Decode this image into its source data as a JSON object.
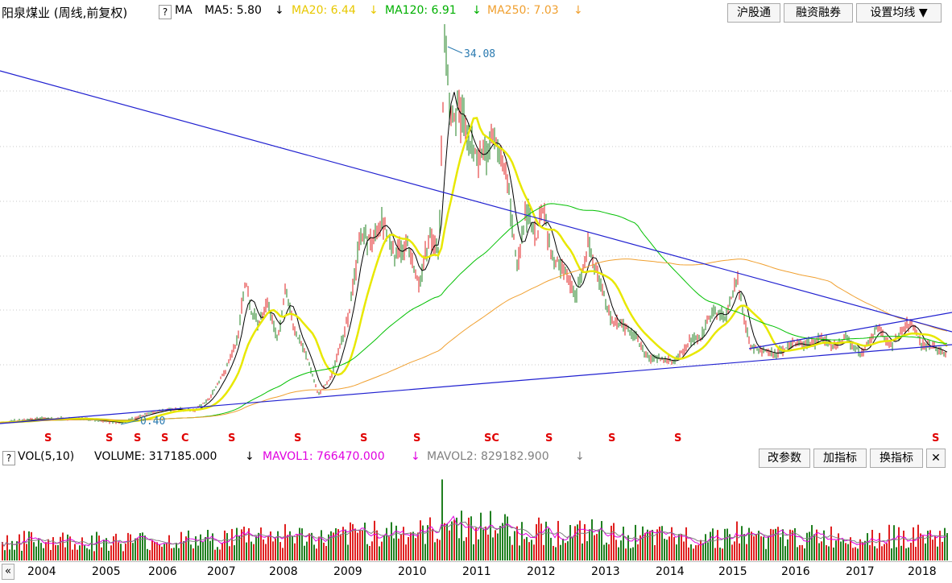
{
  "header": {
    "title": "阳泉煤业 (周线,前复权)",
    "help": "?",
    "ma_label": "MA",
    "ma5": "MA5: 5.80",
    "ma20": "MA20: 6.44",
    "ma120": "MA120: 6.91",
    "ma250": "MA250: 7.03",
    "down_arrow": "↓",
    "buttons": [
      "沪股通",
      "融资融券",
      "设置均线 ▼"
    ]
  },
  "price_annotations": {
    "high": "34.08",
    "low": "0.40"
  },
  "event_markers": [
    "S",
    "S",
    "S",
    "S",
    "C",
    "S",
    "S",
    "S",
    "S",
    "SC",
    "S",
    "S",
    "S",
    "S"
  ],
  "volume_bar": {
    "help": "?",
    "vol": "VOL(5,10)",
    "volume": "VOLUME: 317185.000",
    "mavol1": "MAVOL1: 766470.000",
    "mavol2": "MAVOL2: 829182.900",
    "buttons": [
      "改参数",
      "加指标",
      "换指标"
    ],
    "close": "✕"
  },
  "x_axis": {
    "collapse": "«",
    "years": [
      "2004",
      "2005",
      "2006",
      "2007",
      "2008",
      "2009",
      "2010",
      "2011",
      "2012",
      "2013",
      "2014",
      "2015",
      "2016",
      "2017",
      "2018"
    ]
  },
  "colors": {
    "ma5": "#000000",
    "ma20": "#e8e800",
    "ma120": "#00c000",
    "ma250": "#f0a030",
    "trendline": "#2020d0",
    "up": "#e02020",
    "down": "#208020",
    "marker": "#e00000"
  },
  "chart_data": {
    "type": "line",
    "title": "阳泉煤业 (周线,前复权)",
    "x": [
      "2004",
      "2005",
      "2006",
      "2007",
      "2008",
      "2009",
      "2010",
      "2011",
      "2012",
      "2013",
      "2014",
      "2015",
      "2016",
      "2017",
      "2018"
    ],
    "series": [
      {
        "name": "MA20",
        "values": [
          0.6,
          0.6,
          1.2,
          8.0,
          6.0,
          14.0,
          16.0,
          24.0,
          14.0,
          10.0,
          5.0,
          8.0,
          6.0,
          6.5,
          6.5
        ]
      },
      {
        "name": "MA120",
        "values": [
          0.6,
          0.6,
          0.8,
          2.0,
          4.0,
          7.5,
          11.0,
          16.0,
          18.0,
          15.0,
          10.0,
          8.0,
          7.0,
          7.0,
          6.9
        ]
      },
      {
        "name": "MA250",
        "values": [
          0.6,
          0.6,
          0.7,
          1.0,
          2.5,
          5.0,
          8.0,
          11.0,
          13.0,
          14.0,
          13.0,
          11.0,
          8.5,
          7.5,
          7.0
        ]
      }
    ],
    "annotations": [
      {
        "label": "34.08",
        "x": "2010"
      },
      {
        "label": "0.40",
        "x": "2005"
      }
    ]
  }
}
